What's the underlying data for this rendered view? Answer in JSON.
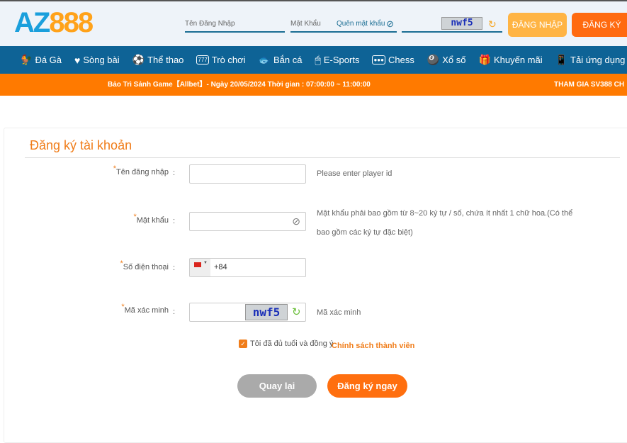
{
  "header": {
    "logo_text": "AZ888",
    "username_placeholder": "Tên Đăng Nhập",
    "password_placeholder": "Mật Khẩu",
    "forgot_password": "Quên mật khẩu",
    "captcha_text": "nwf5",
    "login_button": "ĐĂNG NHẬP",
    "register_button": "ĐĂNG KÝ"
  },
  "nav": {
    "items": [
      {
        "label": "Đá Gà",
        "icon": "rooster-icon",
        "glyph": "🐓"
      },
      {
        "label": "Sòng bài",
        "icon": "casino-chip-icon",
        "glyph": "♥"
      },
      {
        "label": "Thể thao",
        "icon": "soccer-ball-icon",
        "glyph": "⚽"
      },
      {
        "label": "Trò chơi",
        "icon": "slot-777-icon",
        "glyph": "777"
      },
      {
        "label": "Bắn cá",
        "icon": "fish-icon",
        "glyph": "🐟"
      },
      {
        "label": "E-Sports",
        "icon": "mouse-icon",
        "glyph": "🖱"
      },
      {
        "label": "Chess",
        "icon": "chess-icon",
        "glyph": "●●●"
      },
      {
        "label": "Xổ số",
        "icon": "lottery-ball-icon",
        "glyph": "🎱"
      },
      {
        "label": "Khuyến mãi",
        "icon": "gift-icon",
        "glyph": "🎁"
      },
      {
        "label": "Tải ứng dụng",
        "icon": "mobile-download-icon",
        "glyph": "📱"
      }
    ]
  },
  "marquee": {
    "text1": "Bảo Trì Sảnh Game【Allbet】- Ngày 20/05/2024 Thời gian :  07:00:00 ~ 11:00:00",
    "text2": "THAM GIA SV388 CH"
  },
  "form": {
    "title": "Đăng ký tài khoản",
    "username": {
      "label": "Tên đăng nhập",
      "hint": "Please enter player id",
      "value": ""
    },
    "password": {
      "label": "Mật khẩu",
      "hint": "Mật khẩu phải bao gồm từ 8~20 ký tự / số, chứa ít nhất 1 chữ hoa.(Có thể bao gồm các ký tự đặc biệt)",
      "value": ""
    },
    "phone": {
      "label": "Số điện thoại",
      "value": "+84",
      "country": "VN"
    },
    "captcha": {
      "label": "Mã xác minh",
      "hint": "Mã xác minh",
      "image_text": "nwf5",
      "value": ""
    },
    "agree": {
      "checked": true,
      "text": "Tôi đã đủ tuổi và đồng ý",
      "link": "Chính sách thành viên"
    },
    "back_button": "Quay lại",
    "submit_button": "Đăng ký ngay",
    "required_mark": "*",
    "colon": ":"
  },
  "colors": {
    "orange": "#ff7a00",
    "nav_blue": "#0e6396",
    "gray_button": "#aaaaaa"
  }
}
